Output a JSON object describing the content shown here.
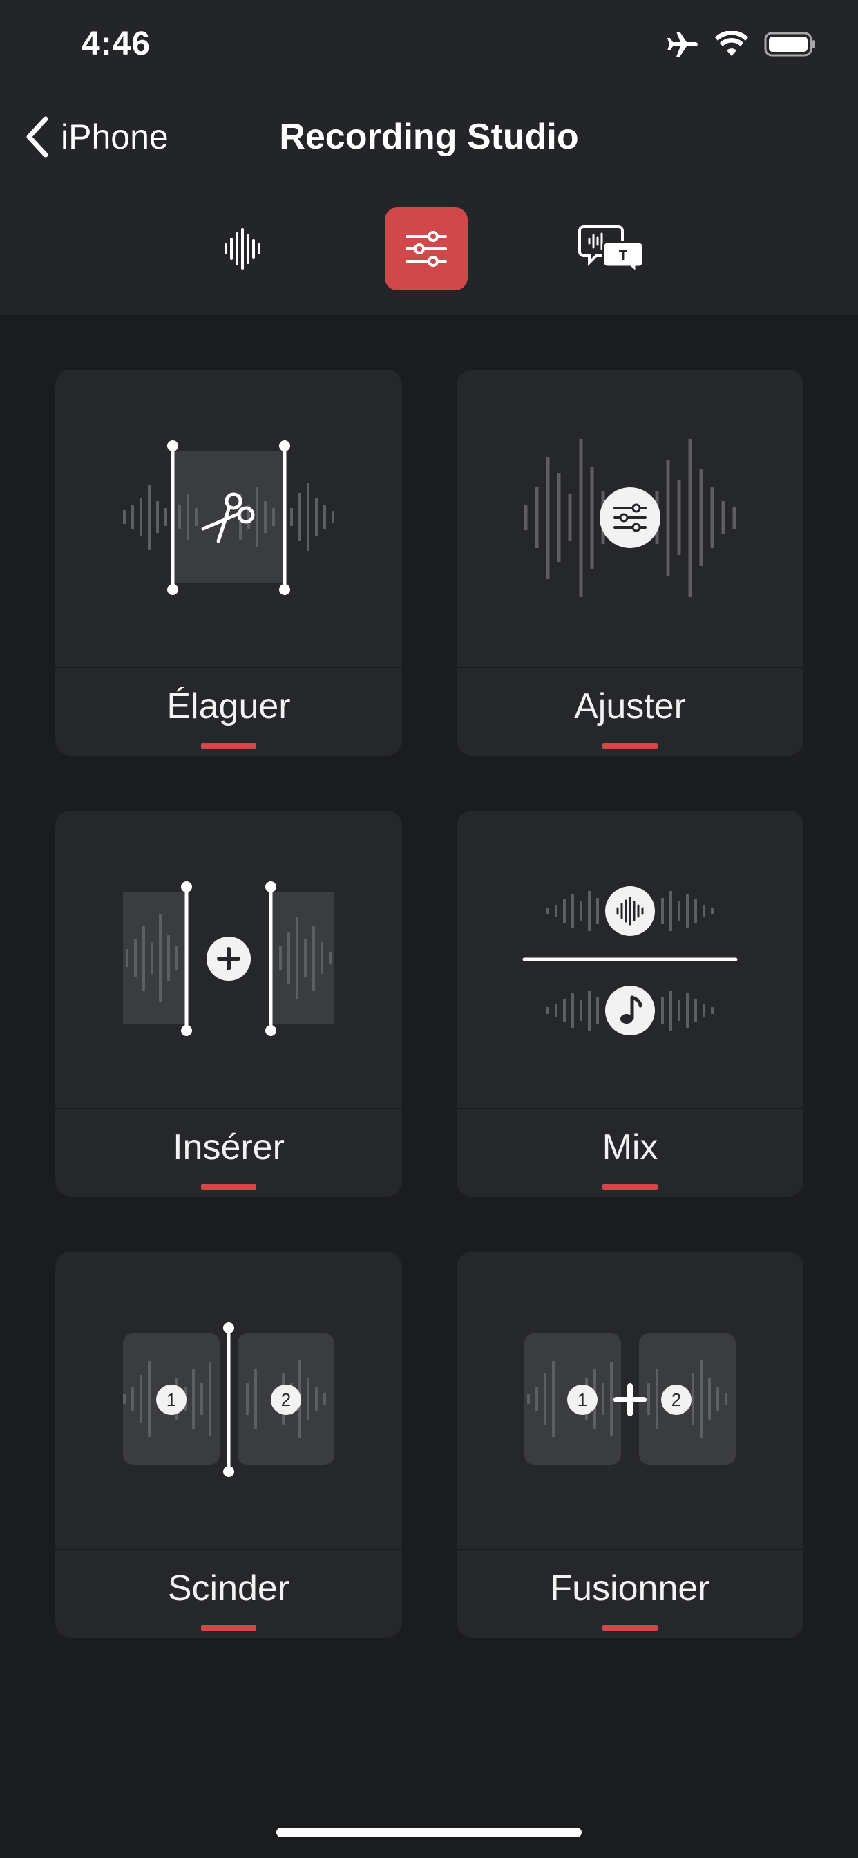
{
  "status_bar": {
    "time": "4:46",
    "icons": [
      "airplane-icon",
      "wifi-icon",
      "battery-icon"
    ]
  },
  "nav": {
    "back_label": "iPhone",
    "title": "Recording Studio"
  },
  "tabs": [
    {
      "icon": "waveform-icon",
      "active": false
    },
    {
      "icon": "sliders-icon",
      "active": true
    },
    {
      "icon": "transcript-bubbles-icon",
      "active": false
    }
  ],
  "cards": [
    {
      "label": "Élaguer",
      "icon": "trim-scissors-icon"
    },
    {
      "label": "Ajuster",
      "icon": "adjust-sliders-icon"
    },
    {
      "label": "Insérer",
      "icon": "insert-plus-icon"
    },
    {
      "label": "Mix",
      "icon": "mix-music-icon"
    },
    {
      "label": "Scinder",
      "icon": "split-icon"
    },
    {
      "label": "Fusionner",
      "icon": "merge-icon"
    }
  ],
  "badges": [
    "1",
    "2"
  ],
  "tab_labels": {
    "trim": "T"
  },
  "colors": {
    "accent": "#d0484a",
    "background": "#1b1c1e",
    "card": "#26272a",
    "header": "#242528",
    "waveform": "#5d5e62"
  }
}
